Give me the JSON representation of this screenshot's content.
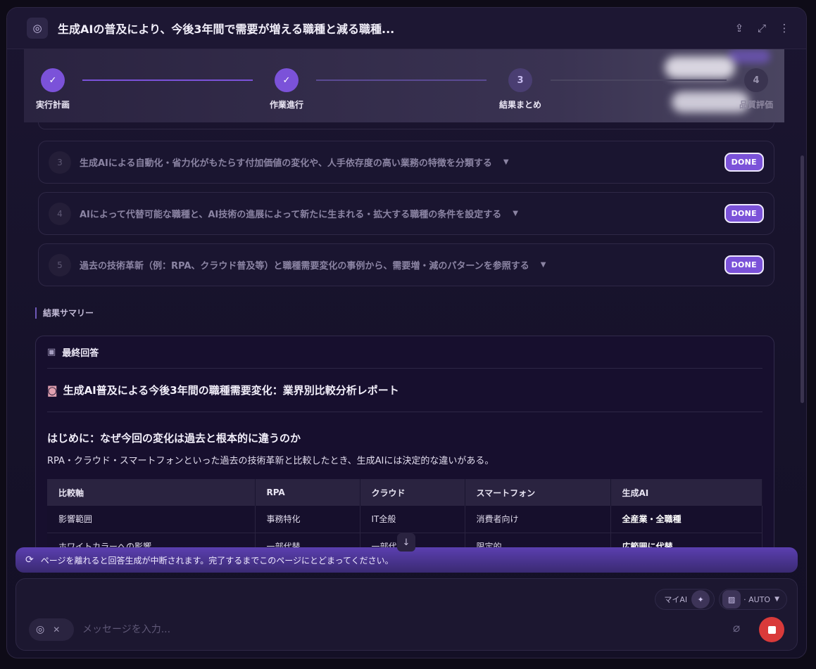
{
  "header": {
    "title": "生成AIの普及により、今後3年間で需要が増える職種と減る職種...",
    "app_icon": "gauge-icon",
    "share_icon": "share-icon",
    "expand_icon": "expand-icon",
    "more_icon": "more-vertical-icon"
  },
  "stepper": {
    "steps": [
      {
        "label": "実行計画",
        "status": "done",
        "marker": "✓"
      },
      {
        "label": "作業進行",
        "status": "done",
        "marker": "✓"
      },
      {
        "label": "結果まとめ",
        "status": "current",
        "marker": "3"
      },
      {
        "label": "品質評価",
        "status": "todo",
        "marker": "4"
      }
    ]
  },
  "tasks": [
    {
      "num": "3",
      "text": "生成AIによる自動化・省力化がもたらす付加価値の変化や、人手依存度の高い業務の特徴を分類する",
      "badge": "DONE"
    },
    {
      "num": "4",
      "text": "AIによって代替可能な職種と、AI技術の進展によって新たに生まれる・拡大する職種の条件を設定する",
      "badge": "DONE"
    },
    {
      "num": "5",
      "text": "過去の技術革新（例：RPA、クラウド普及等）と職種需要変化の事例から、需要増・減のパターンを参照する",
      "badge": "DONE"
    }
  ],
  "summary": {
    "section_label": "結果サマリー",
    "card_title": "最終回答",
    "report_title": "生成AI普及による今後3年間の職種需要変化：業界別比較分析レポート",
    "intro_heading": "はじめに：なぜ今回の変化は過去と根本的に違うのか",
    "intro_text": "RPA・クラウド・スマートフォンといった過去の技術革新と比較したとき、生成AIには決定的な違いがある。",
    "table": {
      "headers": [
        "比較軸",
        "RPA",
        "クラウド",
        "スマートフォン",
        "生成AI"
      ],
      "rows": [
        [
          "影響範囲",
          "事務特化",
          "IT全般",
          "消費者向け",
          "全産業・全職種"
        ],
        [
          "ホワイトカラーへの影響",
          "一部代替",
          "一部代替",
          "限定的",
          "広範囲に代替"
        ]
      ]
    }
  },
  "notice": {
    "text": "ページを離れると回答生成が中断されます。完了するまでこのページにとどまってください。"
  },
  "composer": {
    "my_ai_label": "マイAI",
    "model_label": "· AUTO",
    "placeholder": "メッセージを入力...",
    "chip_icon": "gauge-icon"
  },
  "colors": {
    "accent": "#7b52d9",
    "stop": "#d93a3a",
    "background": "#16122a"
  }
}
